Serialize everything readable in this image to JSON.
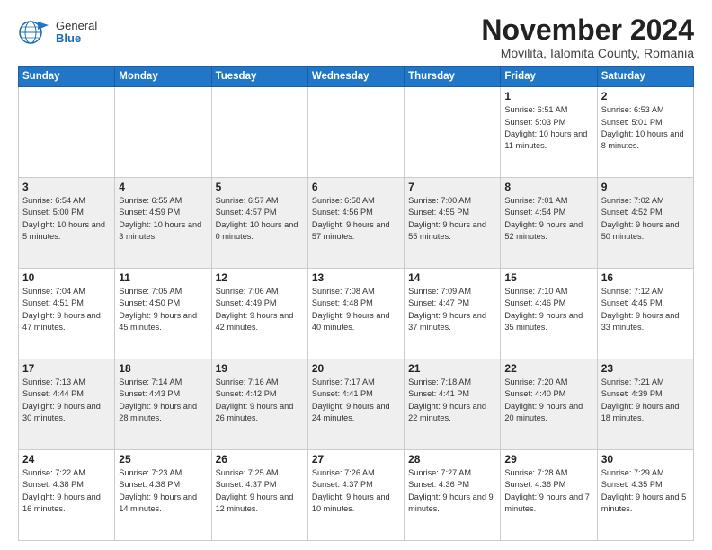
{
  "logo": {
    "general": "General",
    "blue": "Blue"
  },
  "title": "November 2024",
  "location": "Movilita, Ialomita County, Romania",
  "weekdays": [
    "Sunday",
    "Monday",
    "Tuesday",
    "Wednesday",
    "Thursday",
    "Friday",
    "Saturday"
  ],
  "weeks": [
    [
      {
        "day": "",
        "info": ""
      },
      {
        "day": "",
        "info": ""
      },
      {
        "day": "",
        "info": ""
      },
      {
        "day": "",
        "info": ""
      },
      {
        "day": "",
        "info": ""
      },
      {
        "day": "1",
        "info": "Sunrise: 6:51 AM\nSunset: 5:03 PM\nDaylight: 10 hours and 11 minutes."
      },
      {
        "day": "2",
        "info": "Sunrise: 6:53 AM\nSunset: 5:01 PM\nDaylight: 10 hours and 8 minutes."
      }
    ],
    [
      {
        "day": "3",
        "info": "Sunrise: 6:54 AM\nSunset: 5:00 PM\nDaylight: 10 hours and 5 minutes."
      },
      {
        "day": "4",
        "info": "Sunrise: 6:55 AM\nSunset: 4:59 PM\nDaylight: 10 hours and 3 minutes."
      },
      {
        "day": "5",
        "info": "Sunrise: 6:57 AM\nSunset: 4:57 PM\nDaylight: 10 hours and 0 minutes."
      },
      {
        "day": "6",
        "info": "Sunrise: 6:58 AM\nSunset: 4:56 PM\nDaylight: 9 hours and 57 minutes."
      },
      {
        "day": "7",
        "info": "Sunrise: 7:00 AM\nSunset: 4:55 PM\nDaylight: 9 hours and 55 minutes."
      },
      {
        "day": "8",
        "info": "Sunrise: 7:01 AM\nSunset: 4:54 PM\nDaylight: 9 hours and 52 minutes."
      },
      {
        "day": "9",
        "info": "Sunrise: 7:02 AM\nSunset: 4:52 PM\nDaylight: 9 hours and 50 minutes."
      }
    ],
    [
      {
        "day": "10",
        "info": "Sunrise: 7:04 AM\nSunset: 4:51 PM\nDaylight: 9 hours and 47 minutes."
      },
      {
        "day": "11",
        "info": "Sunrise: 7:05 AM\nSunset: 4:50 PM\nDaylight: 9 hours and 45 minutes."
      },
      {
        "day": "12",
        "info": "Sunrise: 7:06 AM\nSunset: 4:49 PM\nDaylight: 9 hours and 42 minutes."
      },
      {
        "day": "13",
        "info": "Sunrise: 7:08 AM\nSunset: 4:48 PM\nDaylight: 9 hours and 40 minutes."
      },
      {
        "day": "14",
        "info": "Sunrise: 7:09 AM\nSunset: 4:47 PM\nDaylight: 9 hours and 37 minutes."
      },
      {
        "day": "15",
        "info": "Sunrise: 7:10 AM\nSunset: 4:46 PM\nDaylight: 9 hours and 35 minutes."
      },
      {
        "day": "16",
        "info": "Sunrise: 7:12 AM\nSunset: 4:45 PM\nDaylight: 9 hours and 33 minutes."
      }
    ],
    [
      {
        "day": "17",
        "info": "Sunrise: 7:13 AM\nSunset: 4:44 PM\nDaylight: 9 hours and 30 minutes."
      },
      {
        "day": "18",
        "info": "Sunrise: 7:14 AM\nSunset: 4:43 PM\nDaylight: 9 hours and 28 minutes."
      },
      {
        "day": "19",
        "info": "Sunrise: 7:16 AM\nSunset: 4:42 PM\nDaylight: 9 hours and 26 minutes."
      },
      {
        "day": "20",
        "info": "Sunrise: 7:17 AM\nSunset: 4:41 PM\nDaylight: 9 hours and 24 minutes."
      },
      {
        "day": "21",
        "info": "Sunrise: 7:18 AM\nSunset: 4:41 PM\nDaylight: 9 hours and 22 minutes."
      },
      {
        "day": "22",
        "info": "Sunrise: 7:20 AM\nSunset: 4:40 PM\nDaylight: 9 hours and 20 minutes."
      },
      {
        "day": "23",
        "info": "Sunrise: 7:21 AM\nSunset: 4:39 PM\nDaylight: 9 hours and 18 minutes."
      }
    ],
    [
      {
        "day": "24",
        "info": "Sunrise: 7:22 AM\nSunset: 4:38 PM\nDaylight: 9 hours and 16 minutes."
      },
      {
        "day": "25",
        "info": "Sunrise: 7:23 AM\nSunset: 4:38 PM\nDaylight: 9 hours and 14 minutes."
      },
      {
        "day": "26",
        "info": "Sunrise: 7:25 AM\nSunset: 4:37 PM\nDaylight: 9 hours and 12 minutes."
      },
      {
        "day": "27",
        "info": "Sunrise: 7:26 AM\nSunset: 4:37 PM\nDaylight: 9 hours and 10 minutes."
      },
      {
        "day": "28",
        "info": "Sunrise: 7:27 AM\nSunset: 4:36 PM\nDaylight: 9 hours and 9 minutes."
      },
      {
        "day": "29",
        "info": "Sunrise: 7:28 AM\nSunset: 4:36 PM\nDaylight: 9 hours and 7 minutes."
      },
      {
        "day": "30",
        "info": "Sunrise: 7:29 AM\nSunset: 4:35 PM\nDaylight: 9 hours and 5 minutes."
      }
    ]
  ]
}
